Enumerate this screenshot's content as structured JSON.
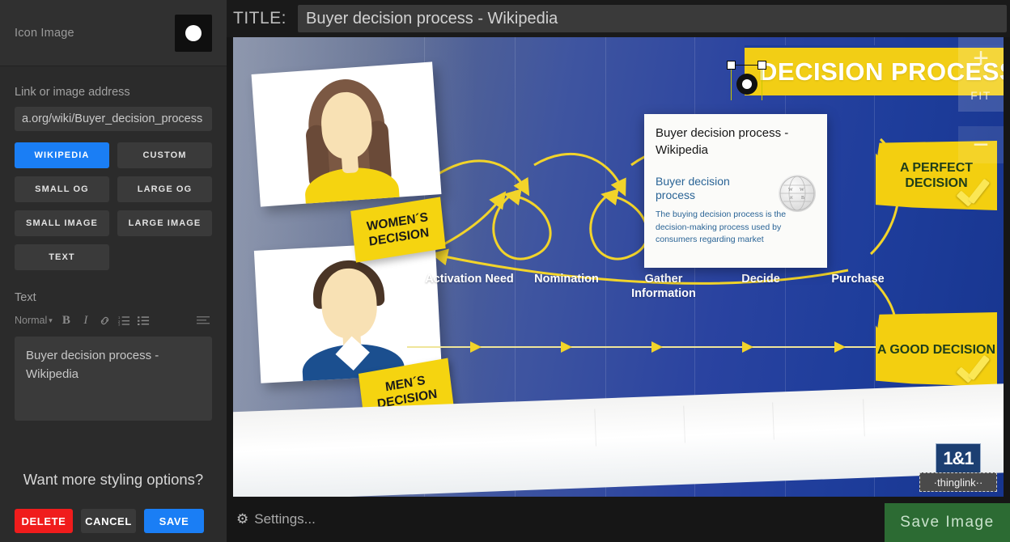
{
  "sidebar": {
    "icon_image_label": "Icon Image",
    "icon_swatch_name": "white-dot-icon",
    "link_label": "Link or image address",
    "url_value": "a.org/wiki/Buyer_decision_process",
    "url_placeholder": "Link or image address",
    "source_buttons": [
      {
        "label": "WIKIPEDIA",
        "active": true,
        "locked": false
      },
      {
        "label": "CUSTOM",
        "active": false,
        "locked": true
      },
      {
        "label": "SMALL OG",
        "active": false,
        "locked": true
      },
      {
        "label": "LARGE OG",
        "active": false,
        "locked": true
      },
      {
        "label": "SMALL IMAGE",
        "active": false,
        "locked": false
      },
      {
        "label": "LARGE IMAGE",
        "active": false,
        "locked": true
      },
      {
        "label": "TEXT",
        "active": false,
        "locked": false
      }
    ],
    "text_label": "Text",
    "toolbar": {
      "style_select": "Normal",
      "bold": "B",
      "italic": "I",
      "link": "ὑ7",
      "ordered_list": "ordered-list-icon",
      "bullet_list": "bullet-list-icon",
      "align": "align-icon"
    },
    "text_value": "Buyer decision process - Wikipedia",
    "styling_note": "Want more styling options?",
    "actions": {
      "delete": "DELETE",
      "cancel": "CANCEL",
      "save": "SAVE"
    }
  },
  "topbar": {
    "title_label": "TITLE:",
    "title_value": "Buyer decision process - Wikipedia",
    "title_placeholder": "Title"
  },
  "canvas": {
    "infographic_title": "DECISION PROCESS",
    "tag_women": "WOMEN´S DECISION",
    "tag_men": "MEN´S DECISION",
    "callout_perfect": "A PERFECT DECISION",
    "callout_good": "A GOOD DECISION",
    "stages": [
      "Activation Need",
      "Nomination",
      "Gather Information",
      "Decide",
      "Purchase"
    ],
    "tooltip": {
      "title": "Buyer decision process - Wikipedia",
      "link_text": "Buyer decision process",
      "body": "The buying decision process is the decision-making process used by consumers regarding market",
      "logo_name": "wikipedia-globe-icon"
    },
    "zoom_controls": {
      "zoom_in": "+",
      "fit": "FIT",
      "zoom_out": "−"
    },
    "watermark": {
      "brand": "1&1",
      "product": "·thinglink··"
    }
  },
  "bottombar": {
    "settings_label": "Settings...",
    "gear_icon": "gear-icon",
    "save_image_label": "Save Image"
  },
  "colors": {
    "accent_blue": "#1a7ef5",
    "delete_red": "#f01c1c",
    "save_green": "#2c6b33",
    "tag_yellow": "#f5d410",
    "canvas_blue": "#2a43a0"
  }
}
